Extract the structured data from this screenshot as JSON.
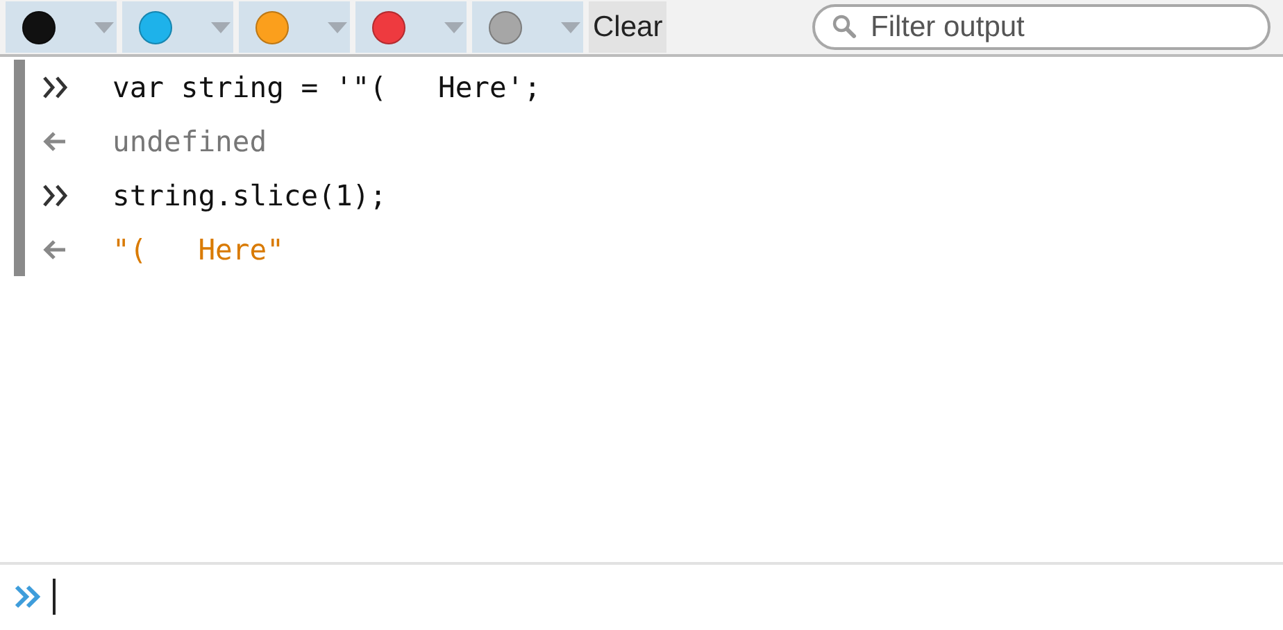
{
  "toolbar": {
    "filters": [
      {
        "color": "#111111"
      },
      {
        "color": "#1eb2ea"
      },
      {
        "color": "#fb9f1c"
      },
      {
        "color": "#ee3a3f"
      },
      {
        "color": "#a6a6a6"
      }
    ],
    "clear_button": "Clear",
    "filter": {
      "placeholder": "Filter output"
    }
  },
  "output": [
    {
      "kind": "input",
      "text": "var string = '\"(   Here';"
    },
    {
      "kind": "undefined",
      "text": "undefined"
    },
    {
      "kind": "input",
      "text": "string.slice(1);"
    },
    {
      "kind": "string",
      "text": "\"(   Here\""
    }
  ]
}
